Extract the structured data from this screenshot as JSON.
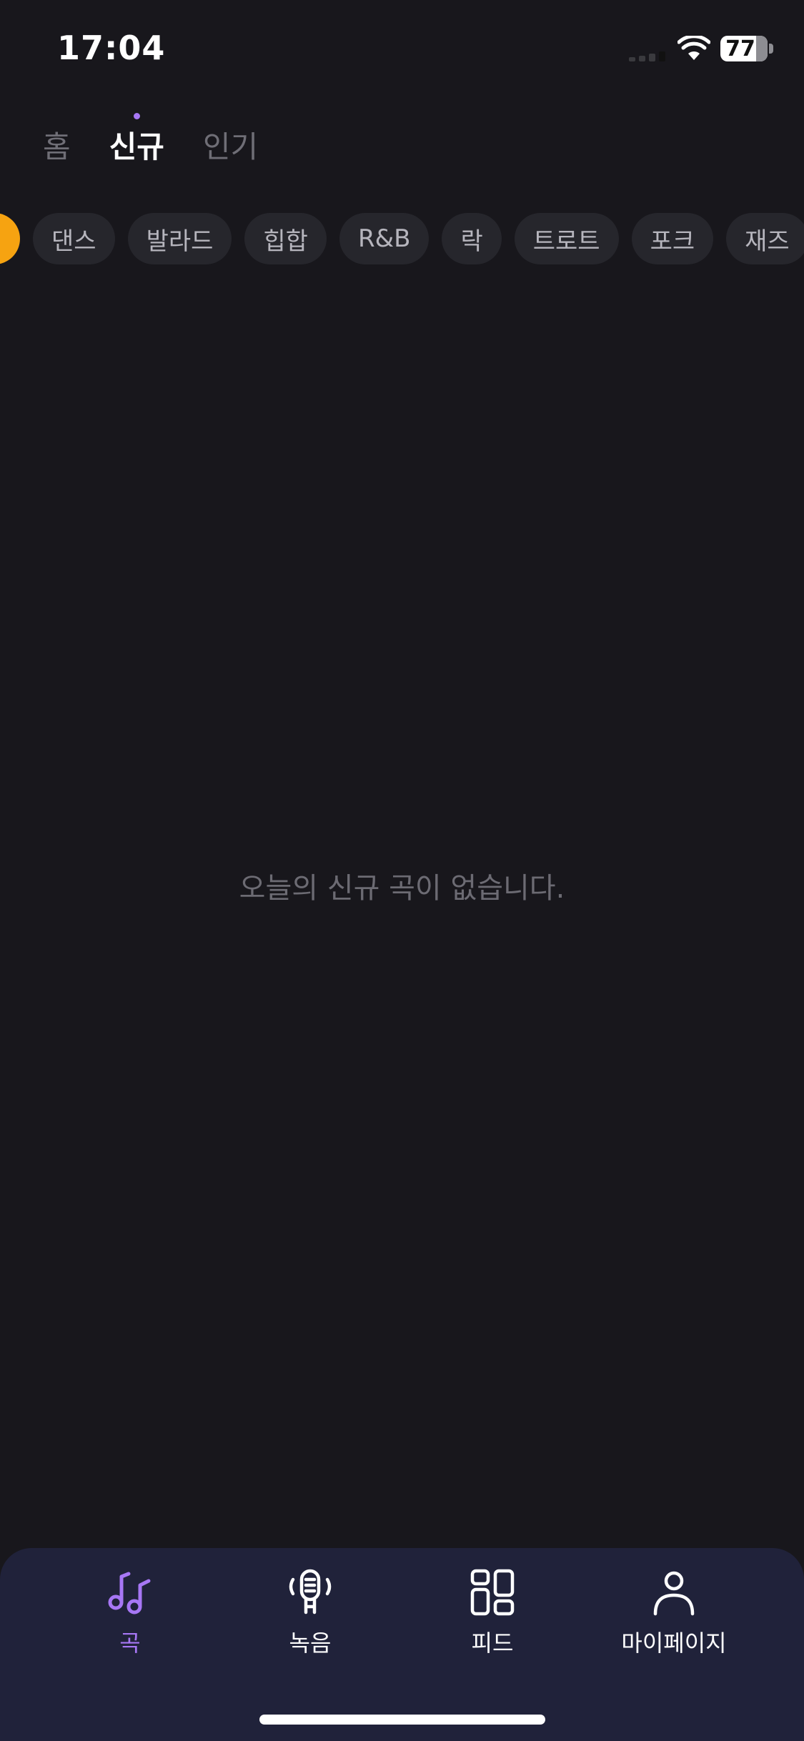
{
  "status_bar": {
    "time": "17:04",
    "battery": "77"
  },
  "top_tabs": [
    {
      "label": "홈",
      "active": false
    },
    {
      "label": "신규",
      "active": true
    },
    {
      "label": "인기",
      "active": false
    }
  ],
  "genres": {
    "items": [
      "댄스",
      "발라드",
      "힙합",
      "R&B",
      "락",
      "트로트",
      "포크",
      "재즈"
    ]
  },
  "empty_state": {
    "message": "오늘의 신규 곡이 없습니다."
  },
  "bottom_nav": {
    "items": [
      {
        "label": "곡",
        "icon": "music-note-icon",
        "active": true
      },
      {
        "label": "녹음",
        "icon": "microphone-icon",
        "active": false
      },
      {
        "label": "피드",
        "icon": "grid-icon",
        "active": false
      },
      {
        "label": "마이페이지",
        "icon": "person-icon",
        "active": false
      }
    ]
  },
  "colors": {
    "background": "#18171c",
    "accent": "#a777f5",
    "chip_selected": "#f6a311",
    "nav_background": "#20223a"
  }
}
